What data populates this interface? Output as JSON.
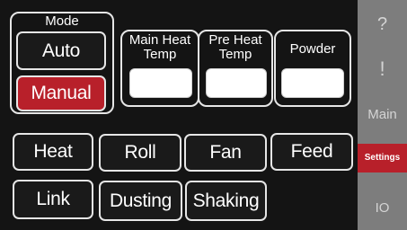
{
  "mode": {
    "title": "Mode",
    "auto_label": "Auto",
    "manual_label": "Manual",
    "selected": "Manual"
  },
  "temps": {
    "main_heat_title_line1": "Main Heat",
    "main_heat_title_line2": "Temp",
    "main_heat_value": "",
    "pre_heat_title_line1": "Pre Heat",
    "pre_heat_title_line2": "Temp",
    "pre_heat_value": "",
    "powder_title": "Powder",
    "powder_value": ""
  },
  "controls": {
    "heat": "Heat",
    "roll": "Roll",
    "fan": "Fan",
    "feed": "Feed",
    "link": "Link",
    "dusting": "Dusting",
    "shaking": "Shaking"
  },
  "sidebar": {
    "help": "?",
    "alarm": "!",
    "main": "Main",
    "settings": "Settings",
    "io": "IO",
    "active": "Settings"
  },
  "colors": {
    "active_red": "#b8202a",
    "sidebar_gray": "#7d7d7d",
    "background": "#141414"
  }
}
